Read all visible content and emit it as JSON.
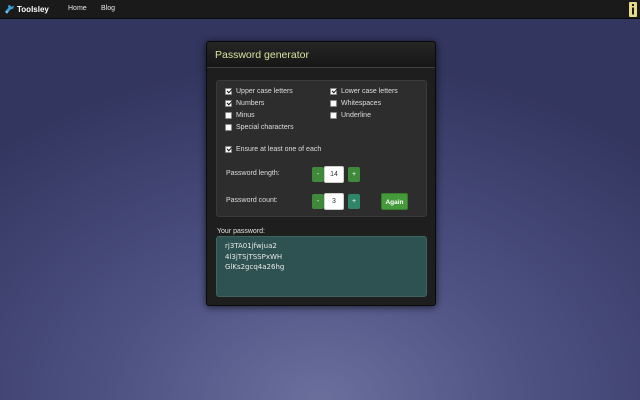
{
  "navbar": {
    "brand": "Toolsley",
    "brand_icon": "toolsley-logo-icon",
    "links": [
      {
        "label": "Home"
      },
      {
        "label": "Blog"
      }
    ],
    "info_icon": "info-icon"
  },
  "panel": {
    "title": "Password generator",
    "options": [
      {
        "label": "Upper case letters",
        "checked": true
      },
      {
        "label": "Lower case letters",
        "checked": true
      },
      {
        "label": "Numbers",
        "checked": true
      },
      {
        "label": "Whitespaces",
        "checked": false
      },
      {
        "label": "Minus",
        "checked": false
      },
      {
        "label": "Underline",
        "checked": false
      },
      {
        "label": "Special characters",
        "checked": false
      },
      {
        "label": "Ensure at least one of each",
        "checked": true
      }
    ],
    "length": {
      "label": "Password length:",
      "minus": "-",
      "value": "14",
      "plus": "+"
    },
    "count": {
      "label": "Password count:",
      "minus": "-",
      "value": "3",
      "plus": "+"
    },
    "again_label": "Again",
    "output_label": "Your password:",
    "passwords": [
      "rj3TA01jfwjua2",
      "4l3jTSjTSSPxWH",
      "GlKs2gcq4a26hg"
    ]
  },
  "colors": {
    "accent_green": "#459a3b",
    "title_yellow": "#d6e4a0",
    "output_bg": "#2e5251"
  }
}
